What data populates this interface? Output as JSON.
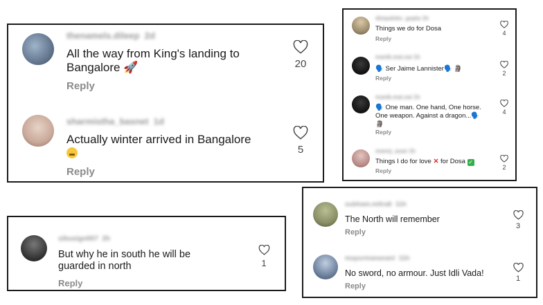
{
  "panels": {
    "p1": {
      "comments": [
        {
          "username": "thenamels.dileep",
          "age": "2d",
          "text": "All the way from King's landing to Bangalore",
          "emoji": "🚀",
          "reply": "Reply",
          "likes": "20",
          "avatar_color": "#5b6e86"
        },
        {
          "username": "sharmistha_basnet",
          "age": "1d",
          "text": "Actually winter arrived in Bangalore",
          "emoji": "😬",
          "reply": "Reply",
          "likes": "5",
          "avatar_color": "#c9a99a"
        }
      ]
    },
    "p2": {
      "comments": [
        {
          "username": "dimpalsks_gupta",
          "age": "1h",
          "text": "Things we do for Dosa",
          "reply": "Reply",
          "likes": "4",
          "avatar_color": "#9c8a6c"
        },
        {
          "username": "manik.mai.nai",
          "age": "1h",
          "text": "🗣️ Ser Jaime Lannister🗣️ 🗿",
          "reply": "Reply",
          "likes": "2",
          "avatar_color": "#1c1c1c"
        },
        {
          "username": "manik.mai.nai",
          "age": "1h",
          "text": "🗣️ One man. One hand, One horse. One weapon. Against a dragon...🗣️ 🗿",
          "reply": "Reply",
          "likes": "4",
          "avatar_color": "#1c1c1c"
        },
        {
          "username": "manoj_asan",
          "age": "1h",
          "text": "Things I do for love ❌ for Dosa ✅",
          "reply": "Reply",
          "likes": "2",
          "avatar_color": "#b88a86"
        }
      ]
    },
    "p3": {
      "comments": [
        {
          "username": "sibusign007",
          "age": "2h",
          "text": "But why he in south he will be guarded in north",
          "reply": "Reply",
          "likes": "1",
          "avatar_color": "#3a3a3a"
        }
      ]
    },
    "p4": {
      "comments": [
        {
          "username": "subham.mitra6",
          "age": "11h",
          "text": "The North will remember",
          "reply": "Reply",
          "likes": "3",
          "avatar_color": "#8a8f66"
        },
        {
          "username": "mayurmanavani",
          "age": "11h",
          "text": "No sword, no armour. Just Idli Vada!",
          "reply": "Reply",
          "likes": "1",
          "avatar_color": "#6f84a0"
        }
      ]
    }
  },
  "icons": {
    "like": "heart-outline-icon"
  },
  "colors": {
    "border": "#1a1a1a",
    "muted": "#8a8a8a",
    "text": "#1a1a1a"
  }
}
